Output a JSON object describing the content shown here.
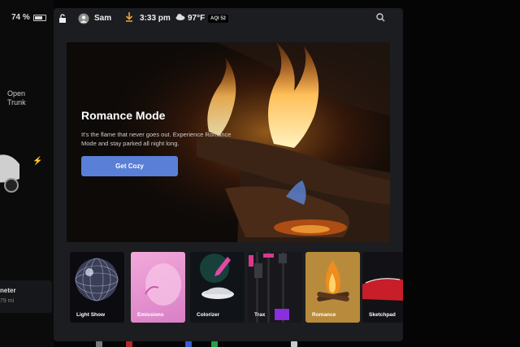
{
  "left_panel": {
    "battery_percent": "74 %",
    "battery_level": 0.74,
    "trunk_label_line1": "Open",
    "trunk_label_line2": "Trunk",
    "odometer_label": "neter",
    "odometer_value": "79 mi"
  },
  "status_bar": {
    "user": "Sam",
    "time": "3:33 pm",
    "temperature": "97°F",
    "aqi": "AQI 52",
    "icons": [
      "lock-icon",
      "user-icon",
      "download-icon",
      "weather-icon",
      "search-icon"
    ]
  },
  "hero": {
    "title": "Romance Mode",
    "description": "It's the flame that never goes out. Experience Romance Mode and stay parked all night long.",
    "cta_label": "Get Cozy",
    "accent_color": "#5a7fd6"
  },
  "tiles": [
    {
      "label": "Light Show"
    },
    {
      "label": "Emissions"
    },
    {
      "label": "Colorizer"
    },
    {
      "label": "Trax"
    },
    {
      "label": "Romance"
    },
    {
      "label": "Sketchpad"
    }
  ]
}
